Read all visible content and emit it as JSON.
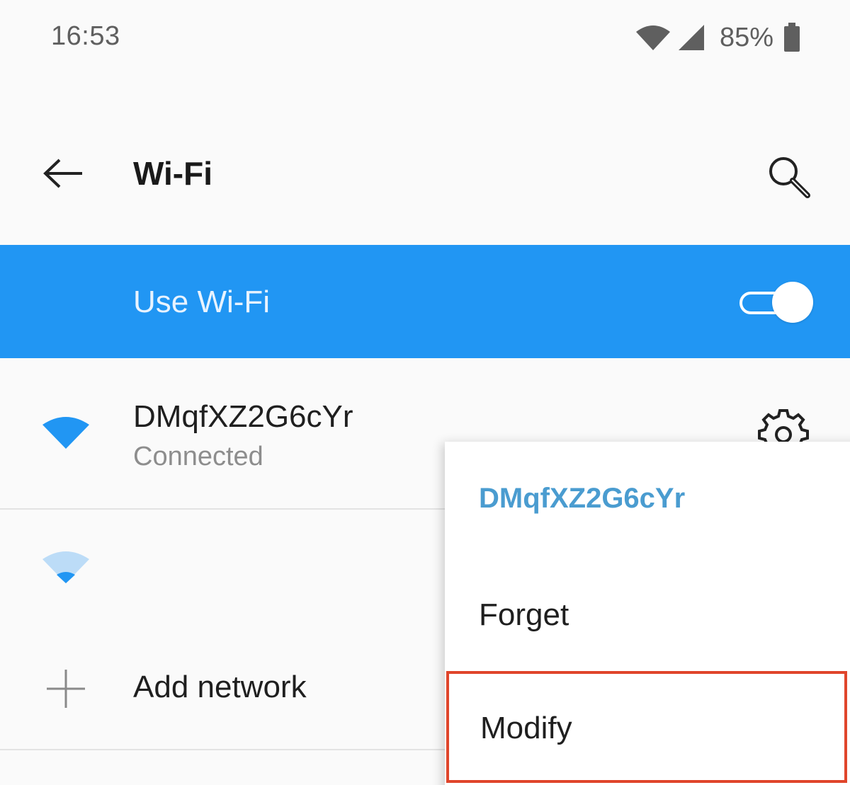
{
  "status_bar": {
    "time": "16:53",
    "battery_percent": "85%",
    "icons": [
      "wifi-icon",
      "cell-signal-icon",
      "battery-icon"
    ]
  },
  "toolbar": {
    "title": "Wi-Fi",
    "back_icon": "arrow-left-icon",
    "search_icon": "search-icon"
  },
  "wifi_master": {
    "label": "Use Wi-Fi",
    "enabled": true,
    "background": "#2196f3"
  },
  "networks": [
    {
      "ssid": "DMqfXZ2G6cYr",
      "status": "Connected",
      "signal_icon": "wifi-strong-icon",
      "settings_icon": "gear-icon"
    },
    {
      "ssid": "",
      "status": "",
      "signal_icon": "wifi-weak-icon"
    }
  ],
  "add_network": {
    "label": "Add network",
    "icon": "plus-icon"
  },
  "popup": {
    "title": "DMqfXZ2G6cYr",
    "items": [
      {
        "label": "Forget"
      },
      {
        "label": "Modify",
        "highlighted": true
      }
    ],
    "highlight_color": "#e0452b",
    "title_color": "#4a9cd0"
  }
}
